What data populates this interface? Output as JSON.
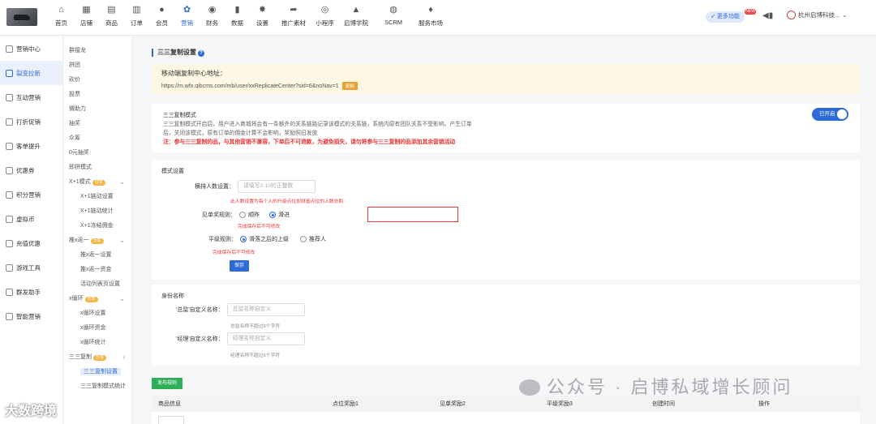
{
  "nav": [
    {
      "icon": "home-icon",
      "glyph": "⌂",
      "label": "首页"
    },
    {
      "icon": "store-icon",
      "glyph": "▦",
      "label": "店铺"
    },
    {
      "icon": "goods-icon",
      "glyph": "▤",
      "label": "商品"
    },
    {
      "icon": "order-icon",
      "glyph": "▥",
      "label": "订单"
    },
    {
      "icon": "member-icon",
      "glyph": "●",
      "label": "会员"
    },
    {
      "icon": "marketing-icon",
      "glyph": "✿",
      "label": "营销",
      "active": true
    },
    {
      "icon": "finance-icon",
      "glyph": "◉",
      "label": "财务"
    },
    {
      "icon": "data-icon",
      "glyph": "▮",
      "label": "数据"
    },
    {
      "icon": "settings-icon",
      "glyph": "✸",
      "label": "设置"
    },
    {
      "icon": "share-icon",
      "glyph": "➦",
      "label": "推广素材"
    },
    {
      "icon": "miniprogram-icon",
      "glyph": "◎",
      "label": "小程序"
    },
    {
      "icon": "academy-icon",
      "glyph": "▲",
      "label": "启博学院"
    },
    {
      "icon": "scrm-icon",
      "glyph": "◍",
      "label": "SCRM"
    },
    {
      "icon": "service-market-icon",
      "glyph": "♦",
      "label": "服务市场"
    }
  ],
  "header": {
    "more_label": "更多功能",
    "more_badge": "NEW",
    "shop_name": "杭州启博科技..."
  },
  "side1": [
    {
      "label": "营销中心"
    },
    {
      "label": "裂变拉新",
      "active": true
    },
    {
      "label": "互动营销"
    },
    {
      "label": "打折促销"
    },
    {
      "label": "客单提升"
    },
    {
      "label": "优惠券"
    },
    {
      "label": "积分营销"
    },
    {
      "label": "虚拟币"
    },
    {
      "label": "充值优惠"
    },
    {
      "label": "游戏工具"
    },
    {
      "label": "群发助手"
    },
    {
      "label": "智能营销"
    }
  ],
  "side2": [
    {
      "label": "群接龙"
    },
    {
      "label": "拼团"
    },
    {
      "label": "砍价"
    },
    {
      "label": "投票"
    },
    {
      "label": "微助力"
    },
    {
      "label": "抽奖"
    },
    {
      "label": "众筹"
    },
    {
      "label": "0元抽奖"
    },
    {
      "label": "即拼模式"
    },
    {
      "label": "X+1模式",
      "tag": "分享",
      "chev": "⌄"
    },
    {
      "label": "X+1链动设置",
      "sub": true
    },
    {
      "label": "X+1链动统计",
      "sub": true
    },
    {
      "label": "X+1冻结佣金",
      "sub": true
    },
    {
      "label": "推x返一",
      "tag": "分享",
      "chev": "⌄"
    },
    {
      "label": "推x返一设置",
      "sub": true
    },
    {
      "label": "推x返一资金",
      "sub": true
    },
    {
      "label": "活动列表页设置",
      "sub": true
    },
    {
      "label": "x循环",
      "tag": "分享",
      "chev": "⌄"
    },
    {
      "label": "x循环设置",
      "sub": true
    },
    {
      "label": "x循环资金",
      "sub": true
    },
    {
      "label": "x循环统计",
      "sub": true
    },
    {
      "label": "三三复制",
      "tag": "分享",
      "chev": "›"
    },
    {
      "label": "三三复制设置",
      "sub": true,
      "active": true
    },
    {
      "label": "三三复制模式统计",
      "sub": true
    }
  ],
  "page": {
    "title": "三三复制设置",
    "link_title": "移动端复制中心地址：",
    "link_url": "https://m.wfx.qibcms.com/mb/user/xxReplicateCenter?sid=6&noNav=1",
    "copy_label": "复制",
    "mode_title": "三三复制模式",
    "mode_desc1": "三三复制模式开启后，用户进入商城将会有一条额外的关系链路记录该模式的关系链，系统内原有团队关系不受影响。产生订单",
    "mode_desc2": "后，关闭该模式，原有订单的佣金计算不会影响，奖励照旧发放",
    "mode_warn": "注：参与三三复制的品，与其他营销不兼容，下单后不可退款，为避免损失，请勿将参与三三复制的品添加其余营销活动",
    "toggle_label": "已开启",
    "settings_title": "模式设置",
    "row_label": "横排人数设置：",
    "row_placeholder": "请填写2-10的正整数",
    "row_hint": "此人数设置为每个人的升级点位加财富点位的人数总和",
    "bonus_label": "见单奖规则：",
    "bonus_opt1": "顺昨",
    "bonus_opt2": "滑进",
    "bonus_hint": "完成保存后不可修改",
    "level_label": "平级规则：",
    "level_opt1": "滑落之后的上级",
    "level_opt2": "推荐人",
    "level_hint": "完成保存后不可修改",
    "save_label": "保存",
    "identity_title": "身份名称",
    "director_label": "'总监'自定义名称：",
    "director_placeholder": "总监名称自定义",
    "director_hint": "总监名称不超过6个字符",
    "manager_label": "'经理'自定义名称：",
    "manager_placeholder": "经理名称自定义",
    "manager_hint": "经理名称不超过6个字符",
    "publish_label": "发布规则"
  },
  "table": {
    "headers": [
      "商品信息",
      "点位奖励1",
      "见单奖励2",
      "平级奖励3",
      "创建时间",
      "操作"
    ]
  },
  "watermark": {
    "main": "公众号 · 启博私域增长顾问",
    "corner": "大数跨境"
  }
}
